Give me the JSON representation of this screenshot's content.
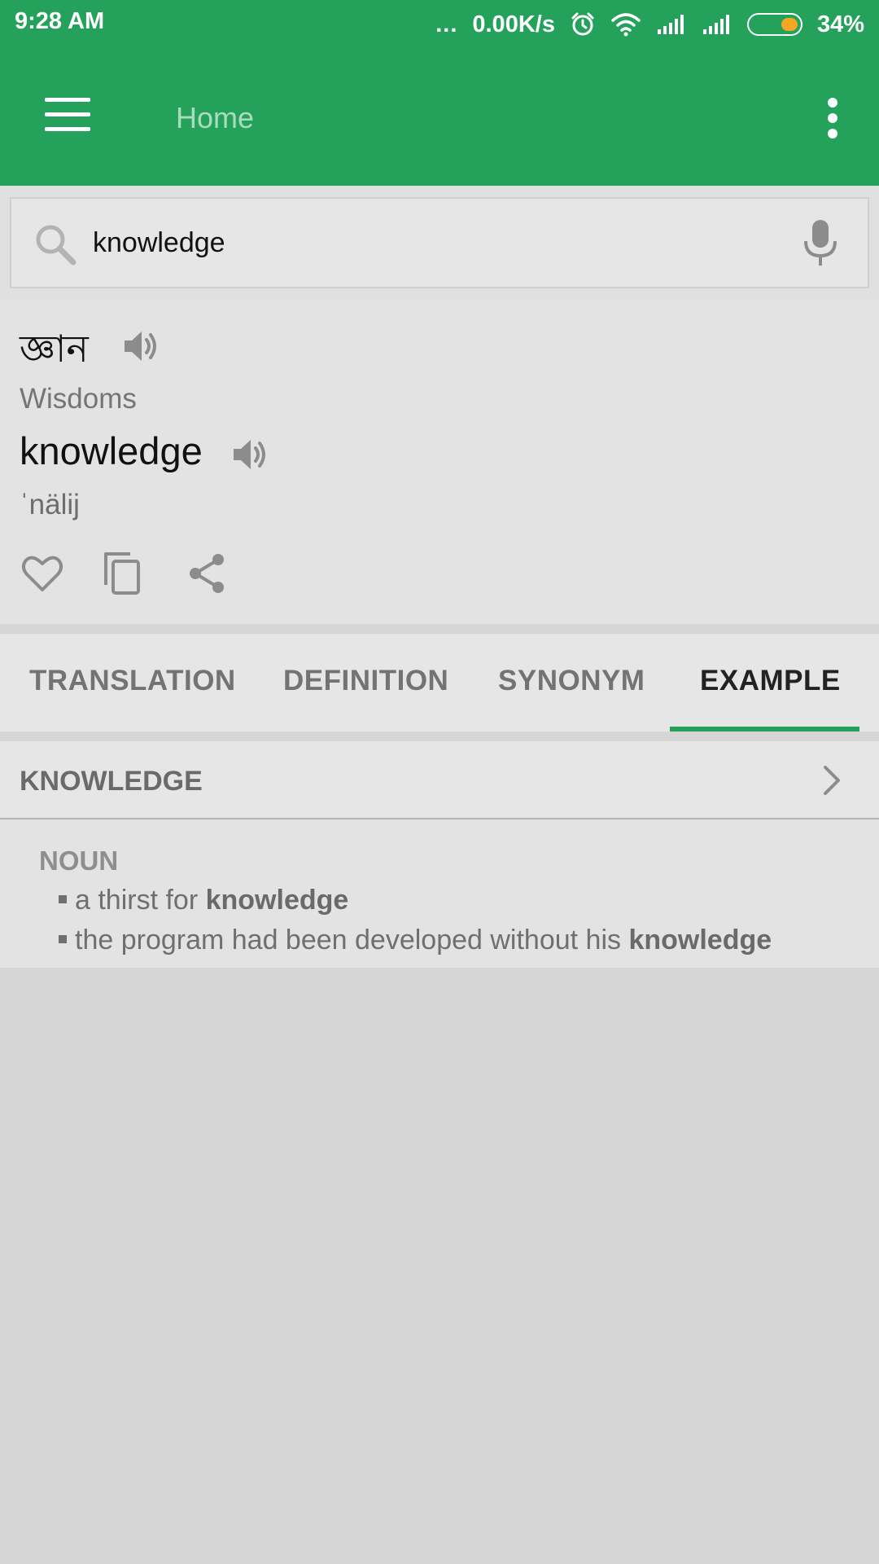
{
  "status_bar": {
    "time": "9:28 AM",
    "network_dots": "...",
    "speed": "0.00K/s",
    "battery_percent": "34%",
    "battery_level": 0.34
  },
  "app_bar": {
    "title": "Home",
    "menu_icon": "hamburger-menu-icon",
    "overflow_icon": "more-vert-icon",
    "color": "#24a15a"
  },
  "search": {
    "value": "knowledge",
    "icon": "search-icon",
    "voice_icon": "mic-icon"
  },
  "word": {
    "translation": "জ্ঞান",
    "transliteration": "Wisdoms",
    "english": "knowledge",
    "pronunciation": "ˈnälij"
  },
  "actions": [
    {
      "name": "favorite",
      "icon": "heart-icon"
    },
    {
      "name": "copy",
      "icon": "copy-icon"
    },
    {
      "name": "share",
      "icon": "share-icon"
    }
  ],
  "tabs": [
    {
      "label": "TRANSLATION",
      "active": false
    },
    {
      "label": "DEFINITION",
      "active": false
    },
    {
      "label": "SYNONYM",
      "active": false
    },
    {
      "label": "EXAMPLE",
      "active": true
    }
  ],
  "example_section": {
    "title": "KNOWLEDGE",
    "part_of_speech": "NOUN",
    "items": [
      {
        "prefix": "a thirst for ",
        "keyword": "knowledge"
      },
      {
        "prefix": "the program had been developed without his ",
        "keyword": "knowledge"
      }
    ]
  }
}
